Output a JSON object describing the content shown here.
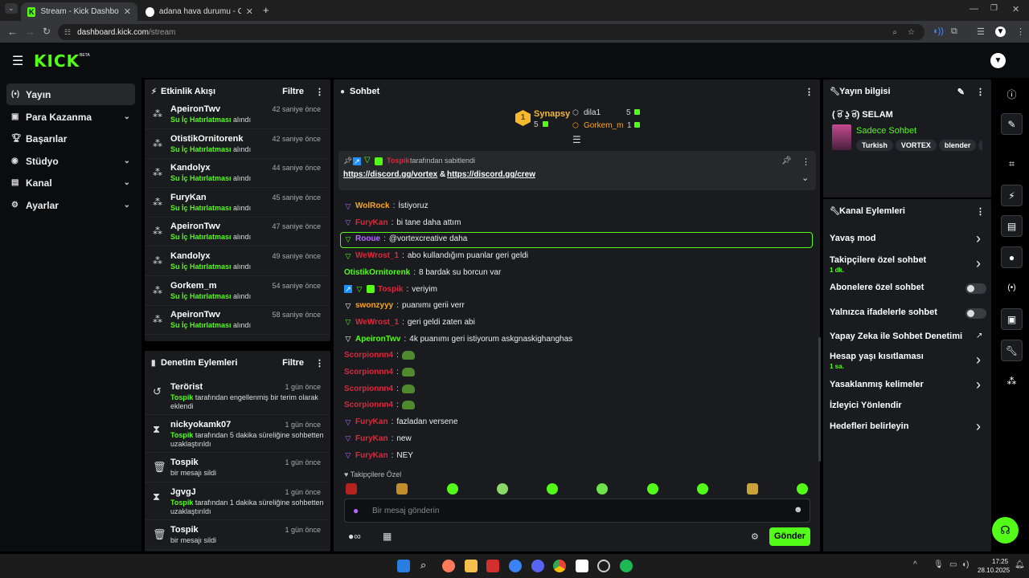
{
  "browser": {
    "tabs": [
      {
        "title": "Stream - Kick Dashboard",
        "active": true
      },
      {
        "title": "adana hava durumu - Google'd",
        "active": false
      }
    ],
    "url_domain": "dashboard.kick.com",
    "url_path": "/stream"
  },
  "kick": {
    "logo": "KICK",
    "beta": "BETA"
  },
  "leftnav": [
    {
      "label": "Yayın",
      "icon": "broadcast-icon",
      "chevron": false,
      "selected": true
    },
    {
      "label": "Para Kazanma",
      "icon": "money-icon",
      "chevron": true,
      "selected": false
    },
    {
      "label": "Başarılar",
      "icon": "trophy-icon",
      "chevron": false,
      "selected": false
    },
    {
      "label": "Stüdyo",
      "icon": "studio-icon",
      "chevron": true,
      "selected": false
    },
    {
      "label": "Kanal",
      "icon": "channel-icon",
      "chevron": true,
      "selected": false
    },
    {
      "label": "Ayarlar",
      "icon": "settings-icon",
      "chevron": true,
      "selected": false
    }
  ],
  "activity": {
    "title": "Etkinlik Akışı",
    "filter": "Filtre",
    "items": [
      {
        "name": "ApeironTwv",
        "time": "42 saniye önce",
        "reward": "Su İç Hatırlatması",
        "suffix": "alındı"
      },
      {
        "name": "OtistikOrnitorenk",
        "time": "42 saniye önce",
        "reward": "Su İç Hatırlatması",
        "suffix": "alındı"
      },
      {
        "name": "Kandolyx",
        "time": "44 saniye önce",
        "reward": "Su İç Hatırlatması",
        "suffix": "alındı"
      },
      {
        "name": "FuryKan",
        "time": "45 saniye önce",
        "reward": "Su İç Hatırlatması",
        "suffix": "alındı"
      },
      {
        "name": "ApeironTwv",
        "time": "47 saniye önce",
        "reward": "Su İç Hatırlatması",
        "suffix": "alındı"
      },
      {
        "name": "Kandolyx",
        "time": "49 saniye önce",
        "reward": "Su İç Hatırlatması",
        "suffix": "alındı"
      },
      {
        "name": "Gorkem_m",
        "time": "54 saniye önce",
        "reward": "Su İç Hatırlatması",
        "suffix": "alındı"
      },
      {
        "name": "ApeironTwv",
        "time": "58 saniye önce",
        "reward": "Su İç Hatırlatması",
        "suffix": "alındı"
      }
    ]
  },
  "moderation": {
    "title": "Denetim Eylemleri",
    "filter": "Filtre",
    "items": [
      {
        "name": "Terörist",
        "time": "1 gün önce",
        "actor": "Tospik",
        "text": "tarafından engellenmiş bir terim olarak eklendi",
        "icon": "undo-icon"
      },
      {
        "name": "nickyokamk07",
        "time": "1 gün önce",
        "actor": "Tospik",
        "text": "tarafından 5 dakika süreliğine sohbetten uzaklaştırıldı",
        "icon": "hourglass-icon"
      },
      {
        "name": "Tospik",
        "time": "1 gün önce",
        "actor": "",
        "text": "bir mesajı sildi",
        "icon": "trash-icon"
      },
      {
        "name": "JgvgJ",
        "time": "1 gün önce",
        "actor": "Tospik",
        "text": "tarafından 1 dakika süreliğine sohbetten uzaklaştırıldı",
        "icon": "hourglass-icon"
      },
      {
        "name": "Tospik",
        "time": "1 gün önce",
        "actor": "",
        "text": "bir mesajı sildi",
        "icon": "trash-icon"
      }
    ]
  },
  "chat": {
    "title": "Sohbet",
    "leaderboard": {
      "first": {
        "rank": "1",
        "name": "Synapsy",
        "count": "5"
      },
      "second": {
        "name": "dila1",
        "count": "5"
      },
      "third": {
        "name": "Gorkem_m",
        "count": "1"
      }
    },
    "pinned": {
      "by": "Tospik",
      "by_text": "tarafından sabitlendi",
      "link1": "https://discord.gg/vortex",
      "amp": "&",
      "link2": "https://discord.gg/crew"
    },
    "messages": [
      {
        "user": "WolRock",
        "color": "#f5a623",
        "text": "İstiyoruz",
        "badges": [
          "vip"
        ]
      },
      {
        "user": "FuryKan",
        "color": "#e2263b",
        "text": "bi tane daha attım",
        "badges": [
          "vip"
        ]
      },
      {
        "user": "Rooue",
        "color": "#b36bff",
        "text": "@vortexcreative daha",
        "badges": [
          "mod"
        ],
        "highlight": true
      },
      {
        "user": "WeWrost_1",
        "color": "#e2263b",
        "text": "abo kullandığım puanlar geri geldi",
        "badges": [
          "mod"
        ]
      },
      {
        "user": "OtistikOrnitorenk",
        "color": "#53fc18",
        "text": "8 bardak su borcun var",
        "badges": []
      },
      {
        "user": "Tospik",
        "color": "#e2263b",
        "text": "veriyim",
        "badges": [
          "broadcaster",
          "mod",
          "sub"
        ]
      },
      {
        "user": "swonzyyy",
        "color": "#f5a623",
        "text": "puanımı gerii verr",
        "badges": [
          "vip-white"
        ]
      },
      {
        "user": "WeWrost_1",
        "color": "#e2263b",
        "text": "geri geldi zaten abi",
        "badges": [
          "mod"
        ]
      },
      {
        "user": "ApeironTwv",
        "color": "#53fc18",
        "text": "4k puanımı geri istiyorum askgnaskighanghas",
        "badges": [
          "vip-white"
        ]
      },
      {
        "user": "Scorpionnn4",
        "color": "#e2263b",
        "text": "",
        "badges": [],
        "emote": true
      },
      {
        "user": "Scorpionnn4",
        "color": "#e2263b",
        "text": "",
        "badges": [],
        "emote": true
      },
      {
        "user": "Scorpionnn4",
        "color": "#e2263b",
        "text": "",
        "badges": [],
        "emote": true
      },
      {
        "user": "Scorpionnn4",
        "color": "#e2263b",
        "text": "",
        "badges": [],
        "emote": true
      },
      {
        "user": "FuryKan",
        "color": "#e2263b",
        "text": "fazladan versene",
        "badges": [
          "vip"
        ]
      },
      {
        "user": "FuryKan",
        "color": "#e2263b",
        "text": "new",
        "badges": [
          "vip"
        ]
      },
      {
        "user": "FuryKan",
        "color": "#e2263b",
        "text": "NEY",
        "badges": [
          "vip"
        ]
      }
    ],
    "followers_only": "Takipçilere Özel",
    "input_placeholder": "Bir mesaj gönderin",
    "send": "Gönder"
  },
  "stream_info": {
    "title": "Yayın bilgisi",
    "stream_title": "( ͡ಠ ʖ̯ ͡ಠ) SELAM",
    "category": "Sadece Sohbet",
    "tags": [
      "Turkish",
      "VORTEX",
      "blender",
      "cre"
    ]
  },
  "channel_actions": {
    "title": "Kanal Eylemleri",
    "items": [
      {
        "label": "Yavaş mod",
        "sub": "",
        "control": "arrow"
      },
      {
        "label": "Takipçilere özel sohbet",
        "sub": "1 dk.",
        "control": "arrow"
      },
      {
        "label": "Abonelere özel sohbet",
        "sub": "",
        "control": "toggle"
      },
      {
        "label": "Yalnızca ifadelerle sohbet",
        "sub": "",
        "control": "toggle"
      },
      {
        "label": "Yapay Zeka ile Sohbet Denetimi",
        "sub": "",
        "control": "external"
      },
      {
        "label": "Hesap yaşı kısıtlaması",
        "sub": "1 sa.",
        "control": "arrow"
      },
      {
        "label": "Yasaklanmış kelimeler",
        "sub": "",
        "control": "arrow"
      },
      {
        "label": "İzleyici Yönlendir",
        "sub": "",
        "control": "none"
      },
      {
        "label": "Hedefleri belirleyin",
        "sub": "",
        "control": "arrow"
      }
    ]
  },
  "taskbar": {
    "time": "17:25",
    "date": "28.10.2025"
  },
  "colors": {
    "accent": "#53fc18",
    "panel": "#191b1f",
    "bg": "#0b0c0e"
  }
}
